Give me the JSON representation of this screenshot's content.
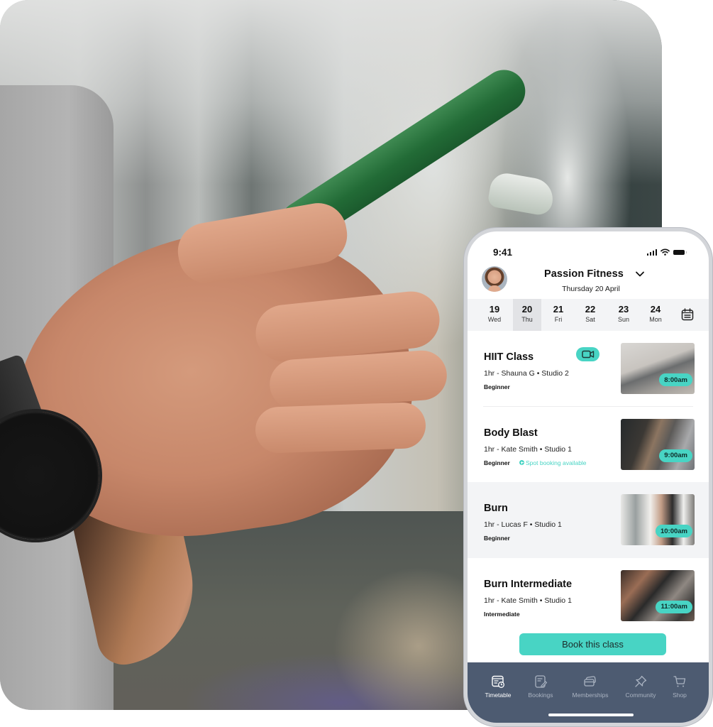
{
  "background_photo": {
    "description": "Blurred gym background with man's hands holding a green phone, wearing a black smartwatch"
  },
  "status_bar": {
    "time": "9:41",
    "icons": [
      "cellular-signal-icon",
      "wifi-icon",
      "battery-icon"
    ]
  },
  "header": {
    "club_name": "Passion Fitness",
    "date": "Thursday 20 April",
    "dropdown_icon": "chevron-down-icon",
    "avatar": "user-avatar"
  },
  "day_strip": {
    "days": [
      {
        "num": "19",
        "name": "Wed",
        "selected": false
      },
      {
        "num": "20",
        "name": "Thu",
        "selected": true
      },
      {
        "num": "21",
        "name": "Fri",
        "selected": false
      },
      {
        "num": "22",
        "name": "Sat",
        "selected": false
      },
      {
        "num": "23",
        "name": "Sun",
        "selected": false
      },
      {
        "num": "24",
        "name": "Mon",
        "selected": false
      }
    ],
    "calendar_icon": "calendar-icon"
  },
  "classes": [
    {
      "title": "HIIT Class",
      "meta": "1hr - Shauna G • Studio 2",
      "level": "Beginner",
      "time": "8:00am",
      "video": true,
      "spot_booking": null,
      "highlighted": false
    },
    {
      "title": "Body Blast",
      "meta": "1hr - Kate Smith • Studio 1",
      "level": "Beginner",
      "time": "9:00am",
      "video": false,
      "spot_booking": "Spot booking available",
      "highlighted": false
    },
    {
      "title": "Burn",
      "meta": "1hr - Lucas F • Studio 1",
      "level": "Beginner",
      "time": "10:00am",
      "video": false,
      "spot_booking": null,
      "highlighted": true
    },
    {
      "title": "Burn Intermediate",
      "meta": "1hr - Kate Smith • Studio 1",
      "level": "Intermediate",
      "time": "11:00am",
      "video": false,
      "spot_booking": null,
      "highlighted": false
    }
  ],
  "book_button": {
    "label": "Book this class"
  },
  "tab_bar": {
    "tabs": [
      {
        "label": "Timetable",
        "icon": "timetable-icon",
        "active": true
      },
      {
        "label": "Bookings",
        "icon": "bookings-icon",
        "active": false
      },
      {
        "label": "Memberships",
        "icon": "memberships-icon",
        "active": false
      },
      {
        "label": "Community",
        "icon": "community-pin-icon",
        "active": false
      },
      {
        "label": "Shop",
        "icon": "cart-icon",
        "active": false
      }
    ]
  },
  "colors": {
    "accent_teal": "#48d4c4",
    "tab_bar_bg": "#4d5b71",
    "row_highlight": "#f3f4f6",
    "day_selected": "#e2e3e6"
  }
}
